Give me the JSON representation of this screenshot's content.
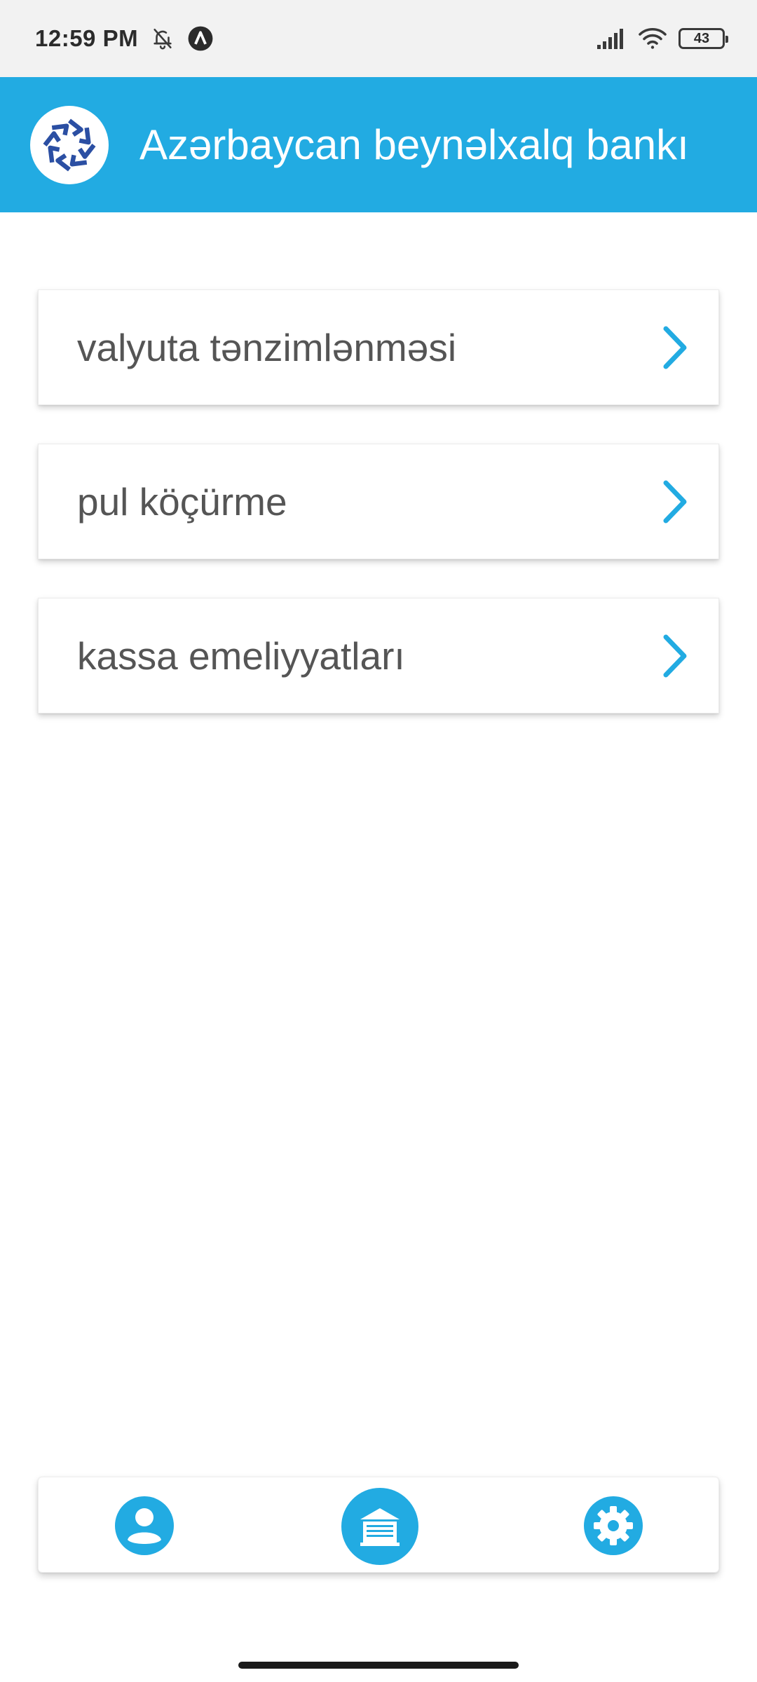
{
  "status_bar": {
    "time": "12:59 PM",
    "battery": "43",
    "icons": [
      "notifications-off-icon",
      "app-a-icon",
      "signal-icon",
      "wifi-icon",
      "battery-icon"
    ]
  },
  "header": {
    "title": "Azərbaycan beynəlxalq bankı",
    "logo_icon": "bank-logo-icon"
  },
  "menu": {
    "items": [
      {
        "label": "valyuta tənzimlənməsi",
        "icon": "chevron-right-icon"
      },
      {
        "label": "pul köçürme",
        "icon": "chevron-right-icon"
      },
      {
        "label": "kassa emeliyyatları",
        "icon": "chevron-right-icon"
      }
    ]
  },
  "bottom_nav": {
    "items": [
      {
        "icon": "profile-icon",
        "active": false
      },
      {
        "icon": "bank-icon",
        "active": true
      },
      {
        "icon": "settings-icon",
        "active": false
      }
    ]
  },
  "colors": {
    "accent": "#22abe2",
    "logo_blue": "#2b4fa3",
    "menu_text": "#555555",
    "status_bar_bg": "#f2f2f2"
  }
}
